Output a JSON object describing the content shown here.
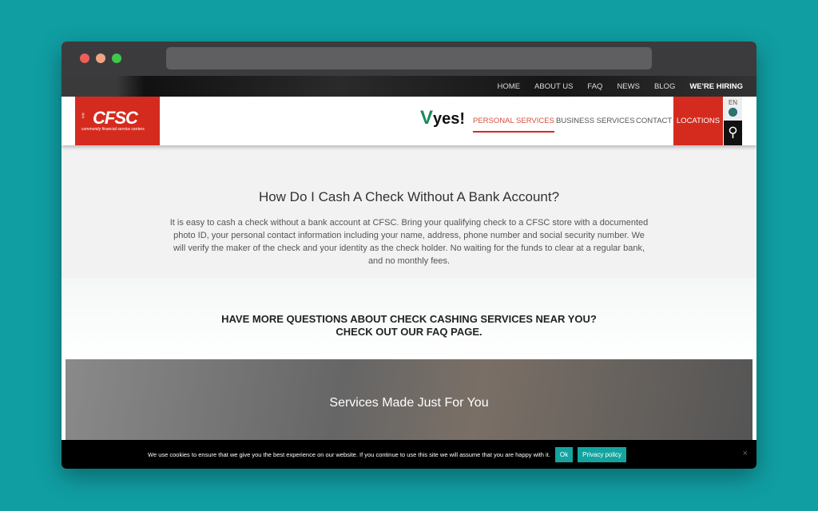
{
  "top_nav": [
    "HOME",
    "ABOUT US",
    "FAQ",
    "NEWS",
    "BLOG",
    "WE'RE HIRING"
  ],
  "logo": {
    "name": "CFSC",
    "tagline": "community financial service centers"
  },
  "partner_logo": "yes!",
  "main_nav": {
    "personal": "PERSONAL SERVICES",
    "business": "BUSINESS SERVICES",
    "contact": "CONTACT",
    "locations": "LOCATIONS",
    "lang": "EN"
  },
  "colors": {
    "brand_red": "#d52b1e",
    "accent_teal": "#14a4a0"
  },
  "content": {
    "title": "How Do I Cash A Check Without A Bank Account?",
    "body": "It is easy to cash a check without a bank account at CFSC. Bring your qualifying check to a CFSC store with a documented photo ID, your personal contact information including your name, address, phone number and social security number. We will verify the maker of the check and your identity as the check holder. No waiting for the funds to clear at a regular bank, and no monthly fees.",
    "faq_line1": "HAVE MORE QUESTIONS ABOUT CHECK CASHING SERVICES NEAR YOU?",
    "faq_line2": "CHECK OUT OUR FAQ PAGE.",
    "services_title": "Services Made Just For You"
  },
  "cookie": {
    "message": "We use cookies to ensure that we give you the best experience on our website. If you continue to use this site we will assume that you are happy with it.",
    "ok": "Ok",
    "privacy": "Privacy policy",
    "close": "×"
  }
}
